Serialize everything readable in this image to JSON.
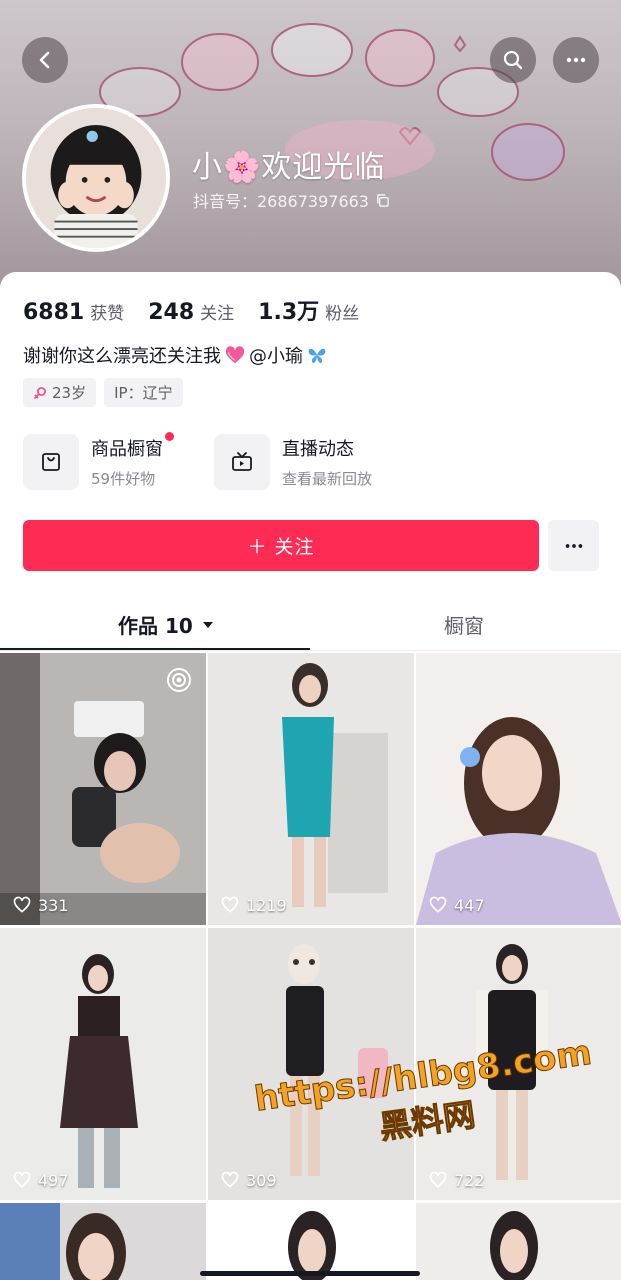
{
  "header": {
    "nickname": "小🌸欢迎光临",
    "douyin_id": "抖音号：26867397663",
    "icons": [
      "back-icon",
      "search-icon",
      "more-icon",
      "copy-icon"
    ]
  },
  "stats": [
    {
      "value": "6881",
      "label": "获赞"
    },
    {
      "value": "248",
      "label": "关注"
    },
    {
      "value": "1.3万",
      "label": "粉丝"
    }
  ],
  "bio": {
    "text": "谢谢你这么漂亮还关注我",
    "mention": "@小瑜"
  },
  "tags": {
    "age": "23岁",
    "ip": "IP：辽宁"
  },
  "entries": [
    {
      "title": "商品橱窗",
      "subtitle": "59件好物",
      "icon": "shopping-bag-icon"
    },
    {
      "title": "直播动态",
      "subtitle": "查看最新回放",
      "icon": "tv-icon"
    }
  ],
  "follow_label": "＋ 关注",
  "tabs": [
    {
      "label": "作品 10",
      "active": true
    },
    {
      "label": "橱窗",
      "active": false
    }
  ],
  "videos": [
    {
      "likes": "331"
    },
    {
      "likes": "1219"
    },
    {
      "likes": "447"
    },
    {
      "likes": "497"
    },
    {
      "likes": "309"
    },
    {
      "likes": "722"
    }
  ],
  "watermark": {
    "line1": "https://hlbg8.com",
    "line2": "黑料网"
  },
  "colors": {
    "accent": "#fe2c55",
    "text": "#161823",
    "secondary": "#5e5f66"
  }
}
